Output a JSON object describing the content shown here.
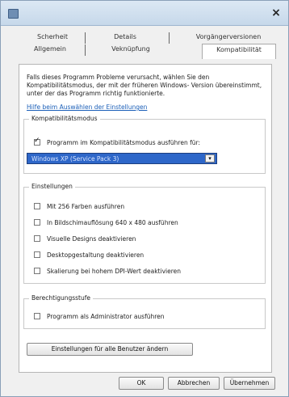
{
  "window": {
    "close_glyph": "×",
    "icon": "app-icon"
  },
  "tabs": {
    "row1": [
      "Scherheit",
      "Details",
      "Vorgängerversionen"
    ],
    "row2": [
      "Allgemein",
      "Veknüpfung",
      "Kompatibilität"
    ]
  },
  "intro": {
    "text": "Falls dieses Programm Probleme verursacht, wählen Sie den Kompatibilitätsmodus, der mit der früheren Windows- Version übereinstimmt, unter der das Programm richtig funktionierte.",
    "link": "Hilfe beim Auswählen der Einstellungen"
  },
  "compat_mode": {
    "legend": "Kompatibilitätsmodus",
    "checkbox_label": "Programm im Kompatibilitätsmodus ausführen für:",
    "checked": true,
    "select_value": "Windows XP (Service Pack 3)",
    "select_arrow": "▾"
  },
  "settings": {
    "legend": "Einstellungen",
    "options": [
      "Mit 256 Farben ausführen",
      "In Bildschimauflösung 640 x 480 ausführen",
      "Visuelle Designs deaktivieren",
      "Desktopgestaltung deaktivieren",
      "Skalierung bei hohem DPI-Wert deaktivieren"
    ]
  },
  "privilege": {
    "legend": "Berechtigungsstufe",
    "checkbox_label": "Programm als Administrator ausführen"
  },
  "buttons": {
    "all_users": "Einstellungen für alle Benutzer ändern",
    "ok": "OK",
    "cancel": "Abbrechen",
    "apply": "Übernehmen"
  }
}
